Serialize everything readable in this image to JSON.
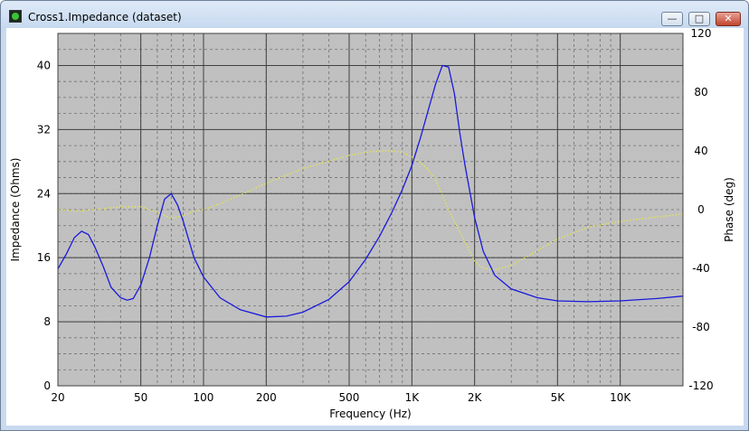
{
  "window": {
    "title": "Cross1.Impedance (dataset)",
    "icon": "app-icon",
    "controls": {
      "minimize": "minimize-icon",
      "maximize": "maximize-icon",
      "close": "close-icon"
    }
  },
  "colors": {
    "plot_bg": "#c0c0c0",
    "grid_major": "#404040",
    "grid_minor": "#707070",
    "impedance": "#1a1adc",
    "phase": "#e8e84a"
  },
  "chart_data": {
    "type": "line",
    "xlabel": "Frequency (Hz)",
    "ylabel": "Impedance (Ohms)",
    "y2label": "Phase (deg)",
    "xscale": "log",
    "xlim": [
      20,
      20000
    ],
    "ylim": [
      0,
      44
    ],
    "y2lim": [
      -120,
      120
    ],
    "grid": true,
    "x_tick_values": [
      20,
      50,
      100,
      200,
      500,
      1000,
      2000,
      5000,
      10000
    ],
    "x_tick_labels": [
      "20",
      "50",
      "100",
      "200",
      "500",
      "1K",
      "2K",
      "5K",
      "10K"
    ],
    "y_ticks": [
      "0",
      "8",
      "16",
      "24",
      "32",
      "40"
    ],
    "y2_ticks": [
      "-120",
      "-80",
      "-40",
      "0",
      "40",
      "80",
      "120"
    ],
    "series": [
      {
        "axis": "left",
        "style": "solid",
        "x": [
          20,
          22,
          24,
          26,
          28,
          30,
          33,
          36,
          40,
          43,
          46,
          50,
          55,
          60,
          65,
          70,
          75,
          80,
          90,
          100,
          120,
          150,
          200,
          250,
          300,
          400,
          500,
          600,
          700,
          800,
          900,
          1000,
          1100,
          1200,
          1300,
          1400,
          1500,
          1600,
          1700,
          1800,
          2000,
          2200,
          2500,
          3000,
          4000,
          5000,
          7000,
          10000,
          15000,
          20000
        ],
        "values": [
          14.6,
          16.5,
          18.5,
          19.3,
          18.9,
          17.4,
          14.9,
          12.3,
          11.0,
          10.7,
          10.9,
          12.6,
          16.0,
          20.0,
          23.3,
          24.0,
          22.6,
          20.5,
          16.0,
          13.6,
          11.0,
          9.5,
          8.6,
          8.7,
          9.2,
          10.8,
          13.0,
          15.8,
          18.7,
          21.6,
          24.5,
          27.5,
          31.0,
          34.5,
          37.7,
          40.0,
          39.8,
          36.5,
          31.5,
          27.5,
          21.0,
          16.8,
          13.8,
          12.1,
          11.0,
          10.6,
          10.5,
          10.6,
          10.9,
          11.2
        ]
      },
      {
        "axis": "right",
        "style": "dotted",
        "x": [
          20,
          25,
          30,
          40,
          50,
          60,
          70,
          80,
          90,
          100,
          120,
          150,
          200,
          300,
          400,
          500,
          600,
          700,
          800,
          900,
          1000,
          1100,
          1200,
          1300,
          1400,
          1500,
          1600,
          1800,
          2000,
          2200,
          2500,
          3000,
          4000,
          5000,
          7000,
          10000,
          15000,
          20000
        ],
        "values": [
          0,
          -1,
          0,
          2,
          2,
          -2,
          -6,
          -4,
          -1,
          0,
          4,
          10,
          18,
          28,
          33,
          37,
          39,
          40,
          40,
          39,
          36,
          32,
          27,
          20,
          10,
          0,
          -8,
          -22,
          -35,
          -40,
          -41,
          -38,
          -28,
          -20,
          -12,
          -8,
          -5,
          -3
        ]
      }
    ]
  }
}
